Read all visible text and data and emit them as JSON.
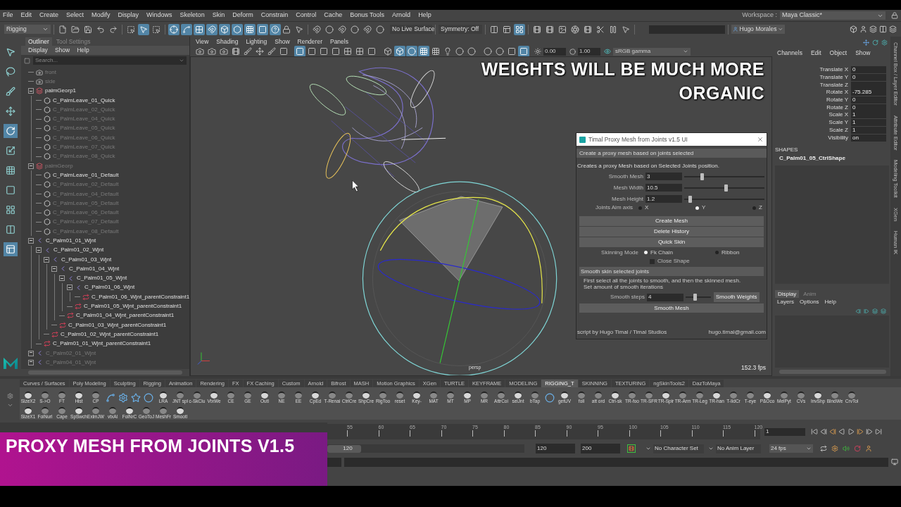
{
  "menu_bar": {
    "items": [
      "File",
      "Edit",
      "Create",
      "Select",
      "Modify",
      "Display",
      "Windows",
      "Skeleton",
      "Skin",
      "Deform",
      "Constrain",
      "Control",
      "Cache",
      "Bonus Tools",
      "Arnold",
      "Help"
    ],
    "workspace_label": "Workspace :",
    "workspace": "Maya Classic*"
  },
  "status_line": {
    "menu_set": "Rigging",
    "tools": [
      {
        "selected": false
      },
      {
        "selected": false
      },
      {
        "selected": false
      },
      {
        "selected": false
      },
      {
        "selected": false
      },
      {
        "selected": false
      },
      {
        "selected": true
      },
      {
        "selected": false
      },
      {
        "selected": true
      },
      {
        "selected": true
      },
      {
        "selected": true
      },
      {
        "selected": true
      },
      {
        "selected": true
      },
      {
        "selected": true
      },
      {
        "selected": true
      },
      {
        "selected": true
      },
      {
        "selected": true
      },
      {
        "selected": false
      },
      {
        "selected": false
      },
      {
        "selected": false
      },
      {
        "selected": false
      },
      {
        "selected": false
      },
      {
        "selected": false
      },
      {
        "selected": false
      },
      {
        "selected": false
      },
      {
        "selected": false
      },
      {
        "selected": false
      },
      {
        "selected": true
      },
      {
        "selected": false
      },
      {
        "selected": false
      },
      {
        "selected": false
      },
      {
        "selected": false
      },
      {
        "selected": false
      },
      {
        "selected": false
      },
      {
        "selected": false
      },
      {
        "selected": false
      }
    ],
    "live_surface": "No Live Surface",
    "symmetry": "Symmetry: Off",
    "user": "Hugo Morales"
  },
  "toolbox": [
    {
      "selected": false
    },
    {
      "selected": false
    },
    {
      "selected": false
    },
    {
      "selected": false
    },
    {
      "selected": true
    },
    {
      "selected": false
    },
    {
      "selected": false
    },
    {
      "selected": false
    },
    {
      "selected": false
    },
    {
      "selected": false
    },
    {
      "selected": true
    }
  ],
  "outliner": {
    "tabs": [
      {
        "label": "Outliner",
        "selected": true
      },
      {
        "label": "Tool Settings",
        "selected": false
      }
    ],
    "menu": [
      "Display",
      "Show",
      "Help"
    ],
    "search_placeholder": "Search...",
    "tree": [
      {
        "label": "front",
        "kind": "camera",
        "hidden": true
      },
      {
        "label": "side",
        "kind": "camera",
        "hidden": true
      },
      {
        "label": "palmGeorp1",
        "kind": "group",
        "hidden": false,
        "expanded": true,
        "children": [
          {
            "label": "C_PalmLeave_01_Quick",
            "kind": "mesh",
            "hidden": false
          },
          {
            "label": "C_PalmLeave_02_Quick",
            "kind": "mesh",
            "hidden": true
          },
          {
            "label": "C_PalmLeave_04_Quick",
            "kind": "mesh",
            "hidden": true
          },
          {
            "label": "C_PalmLeave_05_Quick",
            "kind": "mesh",
            "hidden": true
          },
          {
            "label": "C_PalmLeave_06_Quick",
            "kind": "mesh",
            "hidden": true
          },
          {
            "label": "C_PalmLeave_07_Quick",
            "kind": "mesh",
            "hidden": true
          },
          {
            "label": "C_PalmLeave_08_Quick",
            "kind": "mesh",
            "hidden": true
          }
        ]
      },
      {
        "label": "palmGeorp",
        "kind": "group",
        "hidden": true,
        "expanded": true,
        "children": [
          {
            "label": "C_PalmLeave_01_Default",
            "kind": "mesh",
            "hidden": false
          },
          {
            "label": "C_PalmLeave_02_Default",
            "kind": "mesh",
            "hidden": true
          },
          {
            "label": "C_PalmLeave_04_Default",
            "kind": "mesh",
            "hidden": true
          },
          {
            "label": "C_PalmLeave_05_Default",
            "kind": "mesh",
            "hidden": true
          },
          {
            "label": "C_PalmLeave_06_Default",
            "kind": "mesh",
            "hidden": true
          },
          {
            "label": "C_PalmLeave_07_Default",
            "kind": "mesh",
            "hidden": true
          },
          {
            "label": "C_PalmLeave_08_Default",
            "kind": "mesh",
            "hidden": true
          }
        ]
      },
      {
        "label": "C_Palm01_01_Wjnt",
        "kind": "joint",
        "hidden": false,
        "expanded": true,
        "children": [
          {
            "label": "C_Palm01_02_Wjnt",
            "kind": "joint",
            "hidden": false,
            "expanded": true,
            "children": [
              {
                "label": "C_Palm01_03_Wjnt",
                "kind": "joint",
                "hidden": false,
                "expanded": true,
                "children": [
                  {
                    "label": "C_Palm01_04_Wjnt",
                    "kind": "joint",
                    "hidden": false,
                    "expanded": true,
                    "children": [
                      {
                        "label": "C_Palm01_05_Wjnt",
                        "kind": "joint",
                        "hidden": false,
                        "expanded": true,
                        "children": [
                          {
                            "label": "C_Palm01_06_Wjnt",
                            "kind": "joint",
                            "hidden": false,
                            "expanded": true,
                            "children": [
                              {
                                "label": "C_Palm01_06_Wjnt_parentConstraint1",
                                "kind": "constraint",
                                "hidden": false
                              }
                            ]
                          },
                          {
                            "label": "C_Palm01_05_Wjnt_parentConstraint1",
                            "kind": "constraint",
                            "hidden": false
                          }
                        ]
                      },
                      {
                        "label": "C_Palm01_04_Wjnt_parentConstraint1",
                        "kind": "constraint",
                        "hidden": false
                      }
                    ]
                  },
                  {
                    "label": "C_Palm01_03_Wjnt_parentConstraint1",
                    "kind": "constraint",
                    "hidden": false
                  }
                ]
              },
              {
                "label": "C_Palm01_02_Wjnt_parentConstraint1",
                "kind": "constraint",
                "hidden": false
              }
            ]
          },
          {
            "label": "C_Palm01_01_Wjnt_parentConstraint1",
            "kind": "constraint",
            "hidden": false
          }
        ]
      },
      {
        "label": "C_Palm02_01_Wjnt",
        "kind": "joint",
        "hidden": true,
        "expanded": false
      },
      {
        "label": "C_Palm04_01_Wjnt",
        "kind": "joint",
        "hidden": true,
        "expanded": false
      }
    ]
  },
  "viewport": {
    "menu": [
      "View",
      "Shading",
      "Lighting",
      "Show",
      "Renderer",
      "Panels"
    ],
    "tools": [
      {
        "selected": false
      },
      {
        "selected": false
      },
      {
        "selected": false
      },
      {
        "selected": false
      },
      {
        "selected": false
      },
      {
        "selected": false
      },
      {
        "selected": false
      },
      {
        "selected": false
      },
      {
        "selected": true
      },
      {
        "selected": false
      },
      {
        "selected": false
      },
      {
        "selected": false
      },
      {
        "selected": false
      },
      {
        "selected": false
      },
      {
        "selected": false
      },
      {
        "selected": false
      },
      {
        "selected": true
      },
      {
        "selected": true
      },
      {
        "selected": true
      },
      {
        "selected": false
      },
      {
        "selected": false
      },
      {
        "selected": false
      },
      {
        "selected": false
      },
      {
        "selected": false
      },
      {
        "selected": false
      },
      {
        "selected": false
      },
      {
        "selected": true
      }
    ],
    "exposure": "0.00",
    "gamma": "1.00",
    "color_space": "sRGB gamma",
    "camera": "persp",
    "fps": "152.3 fps",
    "caption": [
      "WEIGHTS WILL BE MUCH MORE",
      "ORGANIC"
    ]
  },
  "dialog": {
    "title": "Timal Proxy Mesh from Joints v1.5 UI",
    "section_1": "Create a proxy mesh based on joints selected",
    "description": "Creates a proxy Mesh based on Selected Joints position.",
    "sliders": [
      {
        "label": "Smooth Mesh",
        "value": "3",
        "level": 0.22
      },
      {
        "label": "Mesh Width",
        "value": "10.5",
        "level": 0.52
      },
      {
        "label": "Mesh Height",
        "value": "1.2",
        "level": 0.07
      }
    ],
    "aim_axis_label": "Joints Aim axis",
    "aim_axis": [
      {
        "label": "X",
        "selected": false
      },
      {
        "label": "Y",
        "selected": true
      },
      {
        "label": "Z",
        "selected": false
      }
    ],
    "buttons": [
      "Create Mesh",
      "Delete History",
      "Quick Skin"
    ],
    "skinning_mode_label": "Skinning Mode",
    "skinning_mode": [
      {
        "label": "Fk Chain",
        "selected": true
      },
      {
        "label": "Ribbon",
        "selected": false
      }
    ],
    "close_shape": {
      "label": "Close Shape",
      "checked": false
    },
    "section_2": "Smooth skin selected joints",
    "instructions": [
      "First select all the joints to smooth, and then the skinned mesh.",
      "Set amount of smooth iterations"
    ],
    "smooth_steps": {
      "label": "Smooth steps",
      "value": "4",
      "level": 0.35
    },
    "smooth_weights_button": "Smooth Weights",
    "smooth_mesh_button": "Smooth Mesh",
    "credit": "script by Hugo Timal / Timal Studios",
    "email": "hugo.timal@gmail.com"
  },
  "channel_box": {
    "menu": [
      "Channels",
      "Edit",
      "Object",
      "Show"
    ],
    "channels": [
      {
        "label": "Translate X",
        "value": "0"
      },
      {
        "label": "Translate Y",
        "value": "0"
      },
      {
        "label": "Translate Z"
      },
      {
        "label": "Rotate X",
        "value": "-75.285"
      },
      {
        "label": "Rotate Y",
        "value": "0"
      },
      {
        "label": "Rotate Z",
        "value": "0"
      },
      {
        "label": "Scale X",
        "value": "1"
      },
      {
        "label": "Scale Y",
        "value": "1"
      },
      {
        "label": "Scale Z",
        "value": "1"
      },
      {
        "label": "Visibility",
        "value": "on"
      }
    ],
    "shapes_heading": "SHAPES",
    "shape": "C_Palm01_05_CtrlShape",
    "layer_tabs": [
      {
        "label": "Display",
        "selected": true
      },
      {
        "label": "Anim",
        "selected": false
      }
    ],
    "layer_menu": [
      "Layers",
      "Options",
      "Help"
    ]
  },
  "side_tabs": [
    "Channel Box / Layer Editor",
    "Attribute Editor",
    "Modeling Toolkit",
    "XGen",
    "Human IK"
  ],
  "shelf": {
    "tabs": [
      {
        "label": "Curves / Surfaces",
        "selected": false
      },
      {
        "label": "Poly Modeling",
        "selected": false
      },
      {
        "label": "Sculpting",
        "selected": false
      },
      {
        "label": "Rigging",
        "selected": false
      },
      {
        "label": "Animation",
        "selected": false
      },
      {
        "label": "Rendering",
        "selected": false
      },
      {
        "label": "FX",
        "selected": false
      },
      {
        "label": "FX Caching",
        "selected": false
      },
      {
        "label": "Custom",
        "selected": false
      },
      {
        "label": "Arnold",
        "selected": false
      },
      {
        "label": "Bifrost",
        "selected": false
      },
      {
        "label": "MASH",
        "selected": false
      },
      {
        "label": "Motion Graphics",
        "selected": false
      },
      {
        "label": "XGen",
        "selected": false
      },
      {
        "label": "TURTLE",
        "selected": false
      },
      {
        "label": "KEYFRAME",
        "selected": false
      },
      {
        "label": "MODELING",
        "selected": false
      },
      {
        "label": "RIGGING_T",
        "selected": true
      },
      {
        "label": "SKINNING",
        "selected": false
      },
      {
        "label": "TEXTURING",
        "selected": false
      },
      {
        "label": "ngSkinTools2",
        "selected": false
      },
      {
        "label": "DazToMaya",
        "selected": false
      }
    ],
    "row_1": [
      {
        "kind": "script",
        "label": "SizeX2"
      },
      {
        "kind": "script",
        "label": "S->O"
      },
      {
        "kind": "script",
        "label": "FT"
      },
      {
        "kind": "script",
        "label": "Hist"
      },
      {
        "kind": "script",
        "label": "CP"
      },
      {
        "kind": "tool"
      },
      {
        "kind": "tool"
      },
      {
        "kind": "tool"
      },
      {
        "kind": "tool"
      },
      {
        "kind": "script",
        "label": "LRA"
      },
      {
        "kind": "script",
        "label": "JNT spl"
      },
      {
        "kind": "script",
        "label": "c-SkClu"
      },
      {
        "kind": "script",
        "label": "VtxWe"
      },
      {
        "kind": "script",
        "label": "CE"
      },
      {
        "kind": "script",
        "label": "GE"
      },
      {
        "kind": "script",
        "label": "Outl"
      },
      {
        "kind": "script",
        "label": "NE"
      },
      {
        "kind": "script",
        "label": "EE"
      },
      {
        "kind": "script",
        "label": "CpEd"
      },
      {
        "kind": "script",
        "label": "T-Renai"
      },
      {
        "kind": "script",
        "label": "CtrlCre"
      },
      {
        "kind": "script",
        "label": "ShpCre"
      },
      {
        "kind": "script",
        "label": "RigToo"
      },
      {
        "kind": "script",
        "label": "reset"
      },
      {
        "kind": "script",
        "label": "Key-"
      },
      {
        "kind": "script",
        "label": "MAT"
      },
      {
        "kind": "script",
        "label": "MT"
      },
      {
        "kind": "script",
        "label": "MP"
      },
      {
        "kind": "script",
        "label": "MR"
      },
      {
        "kind": "script",
        "label": "AttrCoi"
      },
      {
        "kind": "script",
        "label": "selJnt"
      },
      {
        "kind": "script",
        "label": "bTap"
      },
      {
        "kind": "tool"
      },
      {
        "kind": "script",
        "label": "getUV"
      },
      {
        "kind": "script",
        "label": "foll"
      },
      {
        "kind": "script",
        "label": "att ord"
      },
      {
        "kind": "script",
        "label": "Ctrl-sk"
      },
      {
        "kind": "script",
        "label": "TR-foo"
      },
      {
        "kind": "script",
        "label": "TR-SFR"
      },
      {
        "kind": "script",
        "label": "TR-Spir"
      },
      {
        "kind": "script",
        "label": "TR-Arm"
      },
      {
        "kind": "script",
        "label": "TR-Leg"
      },
      {
        "kind": "script",
        "label": "TR-han"
      },
      {
        "kind": "script",
        "label": "T-IidCr"
      },
      {
        "kind": "script",
        "label": "T-eye"
      },
      {
        "kind": "script",
        "label": "P&Oco"
      },
      {
        "kind": "script",
        "label": "MelPyt"
      },
      {
        "kind": "script",
        "label": "CVs"
      },
      {
        "kind": "script",
        "label": "InvShp"
      },
      {
        "kind": "script",
        "label": "BlndWe"
      },
      {
        "kind": "script",
        "label": "CrvTol"
      }
    ],
    "row_2": [
      {
        "kind": "script",
        "label": "SizeX1"
      },
      {
        "kind": "script",
        "label": "FolNurl"
      },
      {
        "kind": "script",
        "label": "Cape"
      },
      {
        "kind": "script",
        "label": "SpSwch"
      },
      {
        "kind": "script",
        "label": "ExlmJW"
      },
      {
        "kind": "script",
        "label": "vtxAl"
      },
      {
        "kind": "script",
        "label": "FolNrC"
      },
      {
        "kind": "script",
        "label": "GeoToJ"
      },
      {
        "kind": "script",
        "label": "MeshFr"
      },
      {
        "kind": "script",
        "label": "Smootl"
      }
    ]
  },
  "timeline": {
    "ticks": [
      "55",
      "60",
      "65",
      "70",
      "75",
      "80",
      "85",
      "90",
      "95",
      "100",
      "105",
      "110",
      "115",
      "120"
    ],
    "current_frame": "1",
    "range_slider": {
      "label": "120",
      "level": 0.17
    },
    "range_end": "120",
    "anim_end": "200",
    "character_set": "No Character Set",
    "anim_layer": "No Anim Layer",
    "fps": "24 fps"
  },
  "banner": "PROXY MESH FROM JOINTS V1.5"
}
